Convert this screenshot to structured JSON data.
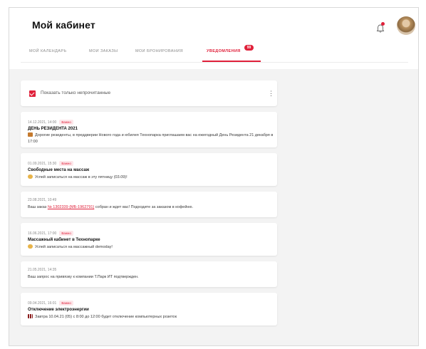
{
  "header": {
    "title": "Мой кабинет"
  },
  "tabs": [
    {
      "label": "МОЙ КАЛЕНДАРЬ"
    },
    {
      "label": "МОИ ЗАКАЗЫ"
    },
    {
      "label": "МОИ БРОНИРОВАНИЯ"
    },
    {
      "label": "УВЕДОМЛЕНИЯ",
      "badge": "99"
    }
  ],
  "filter": {
    "label": "Показать только непрочитанные"
  },
  "notifications": [
    {
      "meta": "14.12.2021, 14:00",
      "badge": "Важно",
      "title": "ДЕНЬ РЕЗИДЕНТА 2021",
      "body": "Дорогие резиденты, в преддверии Нового года и юбилея Технопарка приглашаем вас на ежегодный День Резидента 21 декабря в 17:00",
      "icon": "calendar-icon"
    },
    {
      "meta": "01.09.2021, 15:30",
      "badge": "Важно",
      "title": "Свободные места на массаж",
      "body": "Успей записаться на массаж в эту пятницу (03.09)!",
      "icon": "hand-icon"
    },
    {
      "meta": "23.08.2021, 10:49",
      "body_prefix": "Ваш заказ ",
      "body_link": "№ 1302339 (МБ-1962791)",
      "body_suffix": " собран и ждет вас! Подходите за заказом в кофейню."
    },
    {
      "meta": "16.06.2021, 17:00",
      "badge": "Важно",
      "title": "Массажный кабинет в Технопарке",
      "body": "Успей записаться на массажный demoday!",
      "icon": "hand-icon"
    },
    {
      "meta": "21.05.2021, 14:35",
      "body": "Ваш запрос на привязку к компании Т.Парк ИТ подтвержден."
    },
    {
      "meta": "09.04.2021, 16:01",
      "badge": "Важно",
      "title": "Отключение электроэнергии",
      "body": "Завтра 10.04.21 (05) с 8:00 до 12:00 будет отключение компьютерных розеток",
      "icon": "battery-icon"
    }
  ],
  "colors": {
    "accent": "#e0203a",
    "background": "#f3f3f3"
  }
}
